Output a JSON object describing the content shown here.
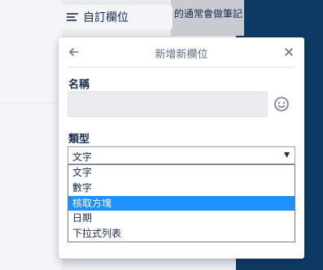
{
  "background": {
    "card_behind_text": "的通常會做筆記"
  },
  "custom_fields_button": {
    "label": "自訂欄位"
  },
  "popover": {
    "title": "新增新欄位",
    "name_label": "名稱",
    "name_value": "",
    "type_label": "類型",
    "type_selected": "文字",
    "type_options": [
      "文字",
      "數字",
      "核取方塊",
      "日期",
      "下拉式列表"
    ],
    "highlighted_option_index": 2
  },
  "colors": {
    "sidebar_dark": "#0e3b63",
    "highlight": "#1e90ff"
  }
}
